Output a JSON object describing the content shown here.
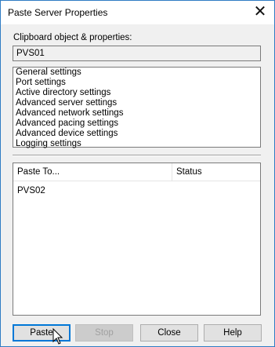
{
  "window": {
    "title": "Paste Server Properties",
    "close_glyph": "✕"
  },
  "clipboard": {
    "label": "Clipboard object & properties:",
    "object_value": "PVS01",
    "settings": [
      "General settings",
      "Port settings",
      "Active directory settings",
      "Advanced server settings",
      "Advanced network settings",
      "Advanced pacing settings",
      "Advanced device settings",
      "Logging settings"
    ]
  },
  "targets": {
    "columns": [
      "Paste To...",
      "Status"
    ],
    "rows": [
      {
        "paste_to": "PVS02",
        "status": ""
      }
    ]
  },
  "buttons": {
    "paste": "Paste",
    "stop": "Stop",
    "close": "Close",
    "help": "Help"
  },
  "icons": {
    "mouse_pointer": "mouse-pointer-icon"
  }
}
